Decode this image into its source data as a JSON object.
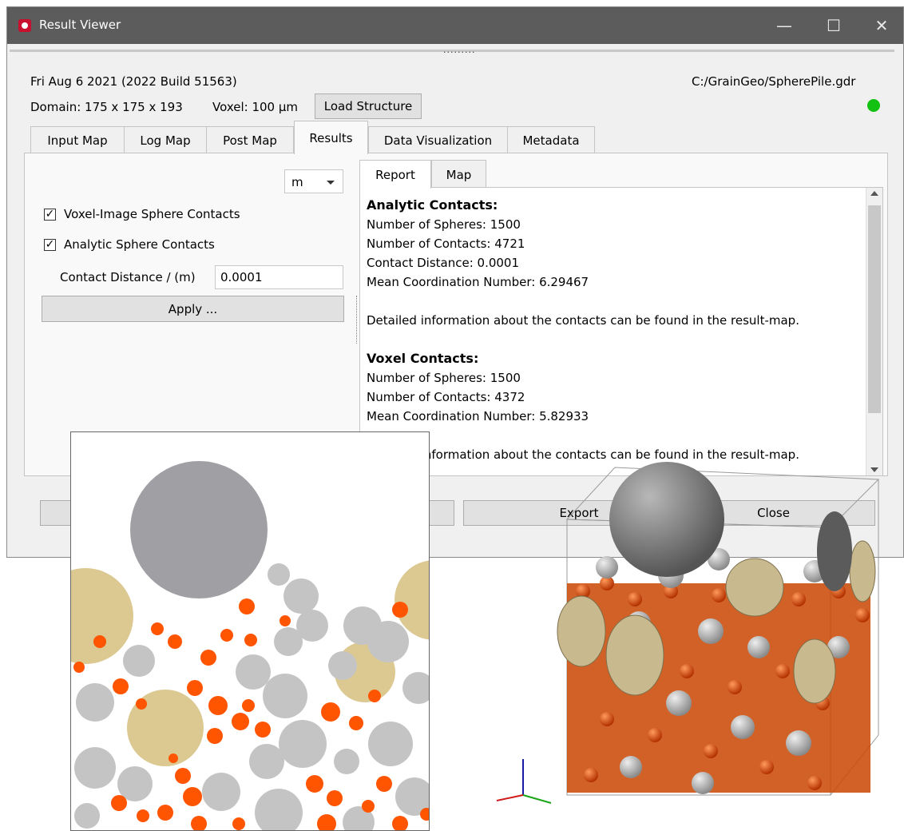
{
  "window": {
    "title": "Result Viewer",
    "controls": {
      "minimize": "—",
      "maximize": "☐",
      "close": "✕"
    }
  },
  "header": {
    "handle_dots": ".........",
    "date_build": "Fri Aug 6 2021 (2022 Build 51563)",
    "file_path": "C:/GrainGeo/SpherePile.gdr",
    "domain": "Domain: 175 x 175 x 193",
    "voxel": "Voxel: 100 µm",
    "load_button": "Load Structure",
    "status_color": "#13c113"
  },
  "tabs": [
    {
      "label": "Input Map"
    },
    {
      "label": "Log Map"
    },
    {
      "label": "Post Map"
    },
    {
      "label": "Results"
    },
    {
      "label": "Data Visualization"
    },
    {
      "label": "Metadata"
    }
  ],
  "active_tab": "Results",
  "left_panel": {
    "unit_select": "m",
    "voxel_check": {
      "label": "Voxel-Image Sphere Contacts",
      "checked": true,
      "mark": "✓"
    },
    "analytic_check": {
      "label": "Analytic Sphere Contacts",
      "checked": true,
      "mark": "✓"
    },
    "contact_distance_label": "Contact Distance / (m)",
    "contact_distance_value": "0.0001",
    "apply_button": "Apply ..."
  },
  "right_panel": {
    "tabs": [
      {
        "label": "Report"
      },
      {
        "label": "Map"
      }
    ],
    "active_tab": "Report",
    "report": {
      "analytic_heading": "Analytic Contacts:",
      "analytic_lines": [
        "Number of Spheres: 1500",
        "Number of Contacts: 4721",
        "Contact Distance: 0.0001",
        "Mean Coordination Number: 6.29467"
      ],
      "analytic_note": "Detailed information about the contacts can be found in the result-map.",
      "voxel_heading": "Voxel Contacts:",
      "voxel_lines": [
        "Number of Spheres: 1500",
        "Number of Contacts: 4372",
        "Mean Coordination Number: 5.82933"
      ],
      "voxel_note": "Detailed information about the contacts can be found in the result-map."
    }
  },
  "footer": {
    "export_button": "Export",
    "close_button": "Close"
  },
  "colors": {
    "large_sphere": "#a09fa3",
    "gray_sphere": "#c4c4c4",
    "tan_sphere": "#dcc992",
    "orange_sphere": "#ff5400"
  }
}
